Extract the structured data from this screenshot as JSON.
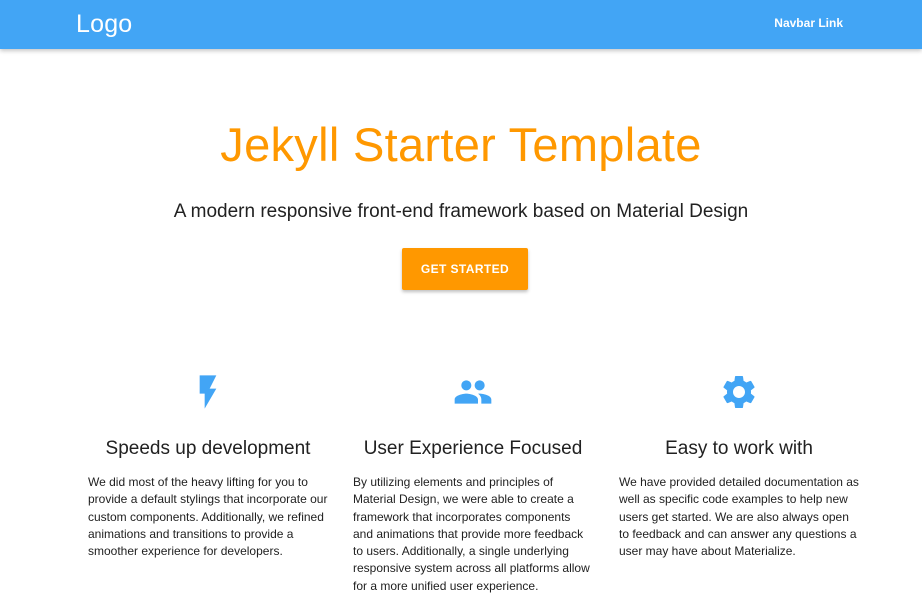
{
  "navbar": {
    "logo": "Logo",
    "link": "Navbar Link",
    "color": "#42a5f5"
  },
  "hero": {
    "title": "Jekyll Starter Template",
    "subtitle": "A modern responsive front-end framework based on Material Design",
    "button_label": "GET STARTED",
    "accent_color": "#ff9800"
  },
  "features": [
    {
      "icon": "flash-icon",
      "title": "Speeds up development",
      "text": "We did most of the heavy lifting for you to provide a default stylings that incorporate our custom components. Additionally, we refined animations and transitions to provide a smoother experience for developers."
    },
    {
      "icon": "group-icon",
      "title": "User Experience Focused",
      "text": "By utilizing elements and principles of Material Design, we were able to create a framework that incorporates components and animations that provide more feedback to users. Additionally, a single underlying responsive system across all platforms allow for a more unified user experience."
    },
    {
      "icon": "settings-icon",
      "title": "Easy to work with",
      "text": "We have provided detailed documentation as well as specific code examples to help new users get started. We are also always open to feedback and can answer any questions a user may have about Materialize."
    }
  ],
  "icon_color": "#42a5f5"
}
